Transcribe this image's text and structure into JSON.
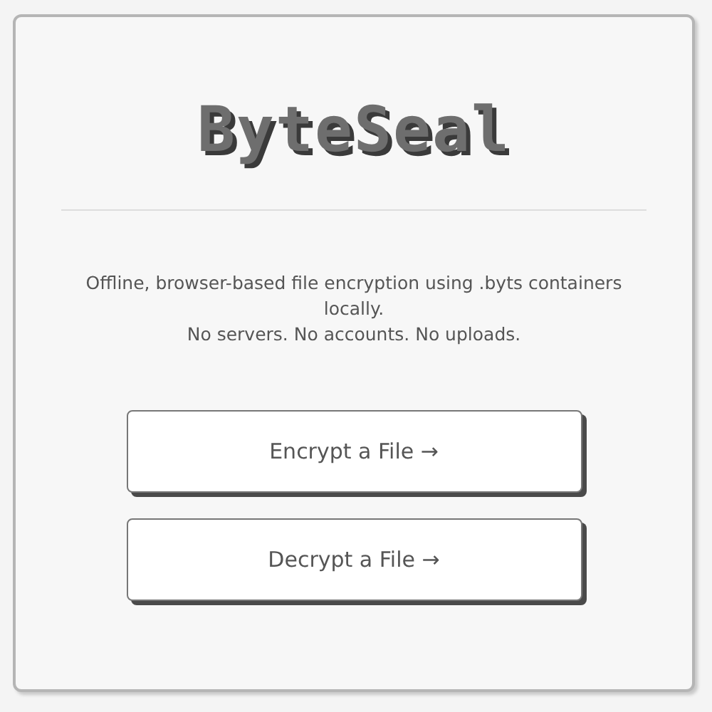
{
  "title": "ByteSeal",
  "description": [
    "Offline, browser-based file encryption using .byts containers locally.",
    "No servers. No accounts. No uploads."
  ],
  "buttons": [
    "Encrypt a File →",
    "Decrypt a File →"
  ]
}
